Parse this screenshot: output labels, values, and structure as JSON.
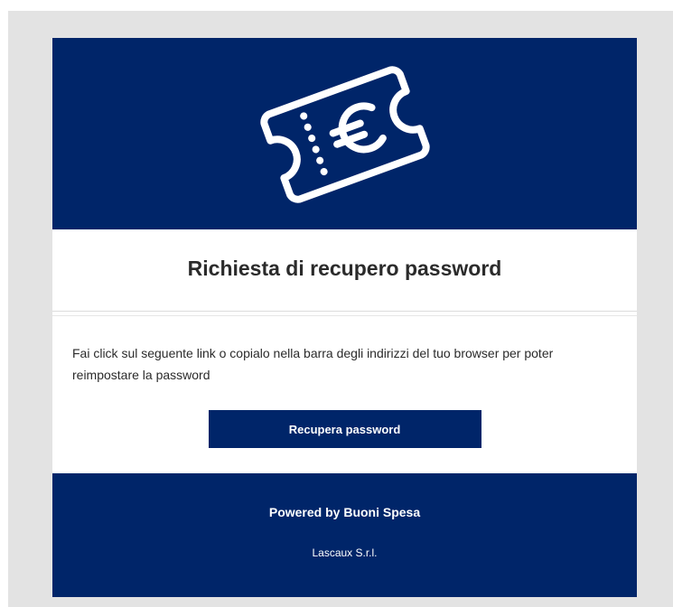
{
  "email": {
    "header": {
      "icon": "euro-ticket-icon"
    },
    "title": "Richiesta di recupero password",
    "message": "Fai click sul seguente link o copialo nella barra degli indirizzi del tuo browser per poter reimpostare la password",
    "button_label": "Recupera password",
    "footer": {
      "powered_by": "Powered by Buoni Spesa",
      "company": "Lascaux S.r.l."
    }
  },
  "colors": {
    "brand_navy": "#002569",
    "background": "#e3e3e3",
    "text": "#2b2b2b"
  }
}
